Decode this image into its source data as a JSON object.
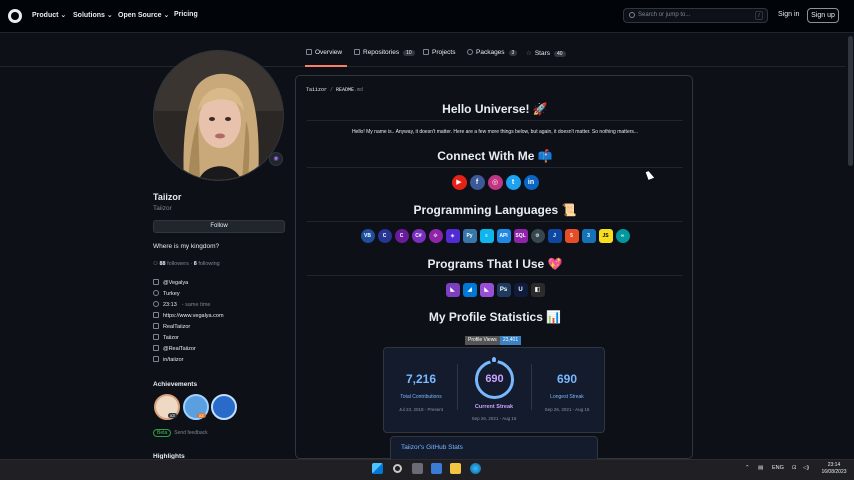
{
  "header": {
    "nav": [
      "Product",
      "Solutions",
      "Open Source",
      "Pricing"
    ],
    "search_placeholder": "Search or jump to...",
    "search_shortcut": "/",
    "signin": "Sign in",
    "signup": "Sign up"
  },
  "tabs": [
    {
      "label": "Overview",
      "count": ""
    },
    {
      "label": "Repositories",
      "count": "10"
    },
    {
      "label": "Projects",
      "count": ""
    },
    {
      "label": "Packages",
      "count": "3"
    },
    {
      "label": "Stars",
      "count": "40"
    }
  ],
  "profile": {
    "name": "Taiizor",
    "username": "Taiizor",
    "follow": "Follow",
    "bio": "Where is my kingdom?",
    "followers_count": "88",
    "followers_label": "followers",
    "following_count": "8",
    "following_label": "following",
    "org": "@Vegalya",
    "location": "Turkey",
    "time": "23:13",
    "time_note": "- same time",
    "website": "https://www.vegalya.com",
    "facebook": "RealTaiizor",
    "social2": "Taiizor",
    "twitter": "@RealTaiizor",
    "linkedin": "in/taiizor",
    "achievements_title": "Achievements",
    "badge1_count": "x3",
    "badge2_count": "x2",
    "beta_pill": "Beta",
    "beta_text": "Send feedback",
    "highlights_title": "Highlights"
  },
  "readme": {
    "breadcrumb_user": "Taiizor",
    "breadcrumb_sep": " / ",
    "breadcrumb_file": "README",
    "breadcrumb_ext": ".md",
    "hello": "Hello Universe! 🚀",
    "intro": "Hello! My name is.. Anyway, it doesn't matter. Here are a few more things below, but again, it doesn't matter. So nothing matters...",
    "connect": "Connect With Me 📫",
    "languages": "Programming Languages 📜",
    "programs": "Programs That I Use 💖",
    "stats": "My Profile Statistics 📊",
    "social_icons": [
      {
        "glyph": "▶",
        "color": "#e62117",
        "name": "youtube-icon"
      },
      {
        "glyph": "f",
        "color": "#3b5998",
        "name": "facebook-icon"
      },
      {
        "glyph": "◎",
        "color": "#c13584",
        "name": "instagram-icon"
      },
      {
        "glyph": "t",
        "color": "#1da1f2",
        "name": "twitter-icon"
      },
      {
        "glyph": "in",
        "color": "#0a66c2",
        "name": "linkedin-icon"
      }
    ],
    "lang_icons": [
      {
        "glyph": "VB",
        "color": "#1f4e9c",
        "round": true,
        "name": "vbnet-icon"
      },
      {
        "glyph": "C",
        "color": "#283593",
        "round": true,
        "name": "c-icon"
      },
      {
        "glyph": "C",
        "color": "#6a1b9a",
        "round": true,
        "name": "cpp-icon"
      },
      {
        "glyph": "C#",
        "color": "#7b2fbe",
        "round": true,
        "name": "csharp-icon"
      },
      {
        "glyph": "⟐",
        "color": "#8e24aa",
        "round": true,
        "name": "dotnet-icon"
      },
      {
        "glyph": "◈",
        "color": "#512bd4",
        "round": false,
        "name": "kotlin-icon"
      },
      {
        "glyph": "Py",
        "color": "#3776ab",
        "round": false,
        "name": "python-icon"
      },
      {
        "glyph": "≡",
        "color": "#0db7ed",
        "round": false,
        "name": "azure-icon"
      },
      {
        "glyph": "API",
        "color": "#1e88e5",
        "round": false,
        "name": "api-icon"
      },
      {
        "glyph": "SQL",
        "color": "#8e24aa",
        "round": false,
        "name": "sql-icon"
      },
      {
        "glyph": "⚙",
        "color": "#37474f",
        "round": true,
        "name": "rust-icon"
      },
      {
        "glyph": "J",
        "color": "#0d47a1",
        "round": false,
        "name": "java-icon"
      },
      {
        "glyph": "5",
        "color": "#e44d26",
        "round": false,
        "name": "html5-icon"
      },
      {
        "glyph": "3",
        "color": "#1572b6",
        "round": false,
        "name": "css3-icon"
      },
      {
        "glyph": "JS",
        "color": "#f7df1e",
        "round": false,
        "name": "javascript-icon"
      },
      {
        "glyph": "∞",
        "color": "#00979d",
        "round": true,
        "name": "arduino-icon"
      }
    ],
    "program_icons": [
      {
        "glyph": "◣",
        "color": "#7b3fc0",
        "name": "visual-studio-icon"
      },
      {
        "glyph": "◢",
        "color": "#0078d7",
        "name": "vscode-icon"
      },
      {
        "glyph": "◣",
        "color": "#9a4dd6",
        "name": "visual-studio-preview-icon"
      },
      {
        "glyph": "Ps",
        "color": "#1e3a5f",
        "name": "photoshop-icon"
      },
      {
        "glyph": "U",
        "color": "#0e1b3a",
        "name": "unreal-icon"
      },
      {
        "glyph": "◧",
        "color": "#2b2b2b",
        "name": "unity-icon"
      }
    ],
    "views_label": "Profile Views",
    "views_value": "23,401",
    "total": "7,216",
    "total_label": "Total Contributions",
    "total_dates": "Jul 23, 2018 - Present",
    "current": "690",
    "current_label": "Current Streak",
    "current_dates": "Sep 26, 2021 - Aug 16",
    "longest": "690",
    "longest_label": "Longest Streak",
    "longest_dates": "Sep 26, 2021 - Aug 16",
    "gh_stats_title": "Taiizor's GitHub Stats"
  },
  "taskbar": {
    "lang": "ENG",
    "time": "23:14",
    "date": "16/08/2023"
  }
}
